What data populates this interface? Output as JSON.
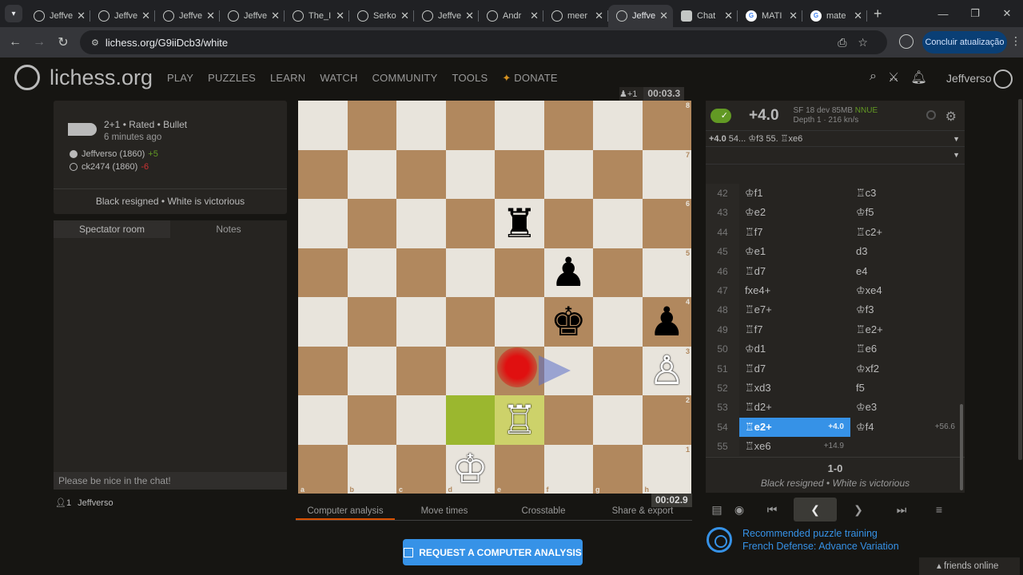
{
  "browser": {
    "tabs": [
      {
        "title": "Jeffve",
        "active": false
      },
      {
        "title": "Jeffve",
        "active": false
      },
      {
        "title": "Jeffve",
        "active": false
      },
      {
        "title": "Jeffve",
        "active": false
      },
      {
        "title": "The_I",
        "active": false
      },
      {
        "title": "Serko",
        "active": false
      },
      {
        "title": "Jeffve",
        "active": false
      },
      {
        "title": "Andr",
        "active": false
      },
      {
        "title": "meer",
        "active": false
      },
      {
        "title": "Jeffve",
        "active": true
      },
      {
        "title": "Chat",
        "active": false
      },
      {
        "title": "MATI",
        "active": false
      },
      {
        "title": "mate",
        "active": false
      }
    ],
    "url": "lichess.org/G9iiDcb3/white",
    "update_button": "Concluir atualização"
  },
  "header": {
    "logo": "lichess.org",
    "nav": [
      "PLAY",
      "PUZZLES",
      "LEARN",
      "WATCH",
      "COMMUNITY",
      "TOOLS"
    ],
    "donate": "DONATE",
    "username": "Jeffverso"
  },
  "game": {
    "type": "2+1 • Rated • Bullet",
    "time_ago": "6 minutes ago",
    "white_player": "Jeffverso (1860)",
    "white_diff": "+5",
    "black_player": "ck2474 (1860)",
    "black_diff": "-6",
    "result_text": "Black resigned • White is victorious"
  },
  "chat": {
    "tab_room": "Spectator room",
    "tab_notes": "Notes",
    "placeholder": "Please be nice in the chat!",
    "watchers_count": "1",
    "watcher": "Jeffverso"
  },
  "board": {
    "top_clock": "00:03.3",
    "top_material": "+1",
    "bottom_clock": "00:02.9",
    "ranks": [
      "8",
      "7",
      "6",
      "5",
      "4",
      "3",
      "2",
      "1"
    ],
    "files": [
      "a",
      "b",
      "c",
      "d",
      "e",
      "f",
      "g",
      "h"
    ],
    "pieces": [
      {
        "square": "e6",
        "glyph": "♜",
        "color": "black"
      },
      {
        "square": "f5",
        "glyph": "♟",
        "color": "black"
      },
      {
        "square": "f4",
        "glyph": "♚",
        "color": "black"
      },
      {
        "square": "h4",
        "glyph": "♟",
        "color": "black"
      },
      {
        "square": "h3",
        "glyph": "♙",
        "color": "white"
      },
      {
        "square": "e2",
        "glyph": "♖",
        "color": "white"
      },
      {
        "square": "d1",
        "glyph": "♔",
        "color": "white"
      }
    ],
    "last_move": [
      "d2",
      "e2"
    ]
  },
  "under_tabs": [
    "Computer analysis",
    "Move times",
    "Crosstable",
    "Share & export"
  ],
  "request_button": "REQUEST A COMPUTER ANALYSIS",
  "analysis": {
    "eval": "+4.0",
    "engine": "SF 18 dev 85MB",
    "nnue": "NNUE",
    "depth": "Depth 1 · 216 kn/s",
    "pv_eval": "+4.0",
    "pv_moves": "54... ♔f3 55. ♖xe6"
  },
  "moves": [
    {
      "n": "42",
      "w": "♔f1",
      "b": "♖c3"
    },
    {
      "n": "43",
      "w": "♔e2",
      "b": "♔f5"
    },
    {
      "n": "44",
      "w": "♖f7",
      "b": "♖c2+"
    },
    {
      "n": "45",
      "w": "♔e1",
      "b": "d3"
    },
    {
      "n": "46",
      "w": "♖d7",
      "b": "e4"
    },
    {
      "n": "47",
      "w": "fxe4+",
      "b": "♔xe4"
    },
    {
      "n": "48",
      "w": "♖e7+",
      "b": "♔f3"
    },
    {
      "n": "49",
      "w": "♖f7",
      "b": "♖e2+"
    },
    {
      "n": "50",
      "w": "♔d1",
      "b": "♖e6"
    },
    {
      "n": "51",
      "w": "♖d7",
      "b": "♔xf2"
    },
    {
      "n": "52",
      "w": "♖xd3",
      "b": "f5"
    },
    {
      "n": "53",
      "w": "♖d2+",
      "b": "♔e3"
    },
    {
      "n": "54",
      "w": "♖e2+",
      "w_eval": "+4.0",
      "b": "♔f4",
      "b_eval": "+56.6",
      "current": "w"
    },
    {
      "n": "55",
      "w": "♖xe6",
      "w_eval": "+14.9",
      "b": ""
    }
  ],
  "final": {
    "score": "1-0",
    "text": "Black resigned • White is victorious"
  },
  "recommend": {
    "line1": "Recommended puzzle training",
    "line2": "French Defense: Advance Variation"
  },
  "friends": "friends online"
}
